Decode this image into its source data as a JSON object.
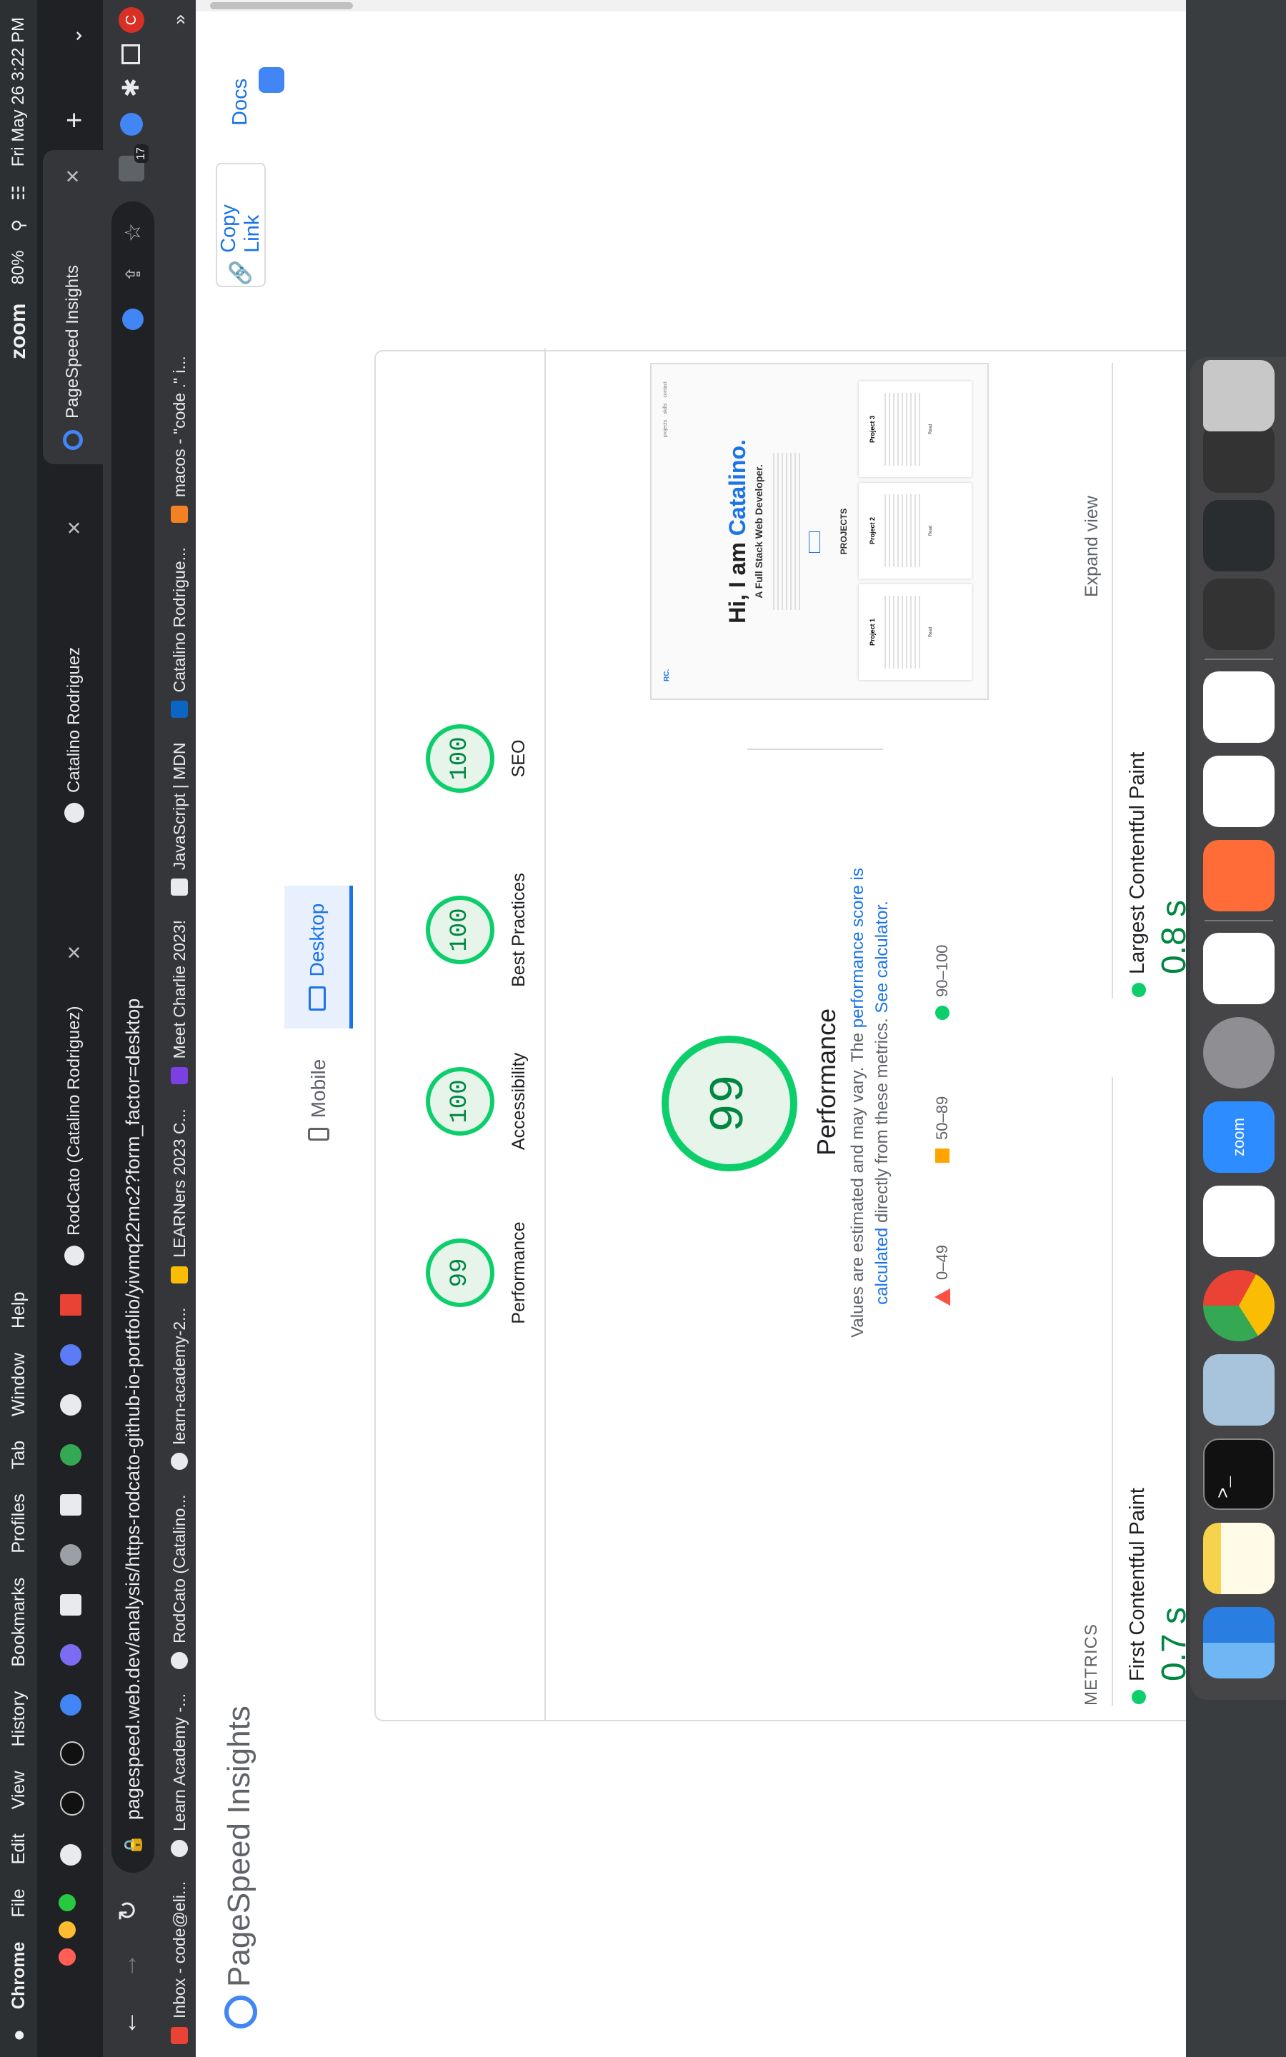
{
  "menubar": {
    "apple_icon": "apple-logo-icon",
    "items": [
      "Chrome",
      "File",
      "Edit",
      "View",
      "History",
      "Bookmarks",
      "Profiles",
      "Tab",
      "Window",
      "Help"
    ],
    "status": {
      "zoom": "zoom",
      "battery": "80%",
      "datetime": "Fri May 26  3:22 PM"
    }
  },
  "browser": {
    "active_tab": {
      "title": "PageSpeed Insights"
    },
    "other_tabs": [
      "RodCato (Catalino Rodriguez)",
      "Catalino Rodriguez"
    ],
    "url": "pagespeed.web.dev/analysis/https-rodcato-github-io-portfolio/yivmq22mc2?form_factor=desktop",
    "extension_badge": "17",
    "bookmarks": [
      "Inbox - code@eli...",
      "Learn Academy -...",
      "RodCato (Catalino...",
      "learn-academy-2...",
      "LEARNers 2023 C...",
      "Meet Charlie 2023!",
      "JavaScript | MDN",
      "Catalino Rodrigue...",
      "macos - \"code .\" i..."
    ]
  },
  "psi": {
    "title": "PageSpeed Insights",
    "copy_link": "Copy Link",
    "docs": "Docs",
    "tabs": {
      "mobile": "Mobile",
      "desktop": "Desktop"
    },
    "scores": [
      {
        "label": "Performance",
        "value": "99"
      },
      {
        "label": "Accessibility",
        "value": "100"
      },
      {
        "label": "Best Practices",
        "value": "100"
      },
      {
        "label": "SEO",
        "value": "100"
      }
    ],
    "performance": {
      "score": "99",
      "title": "Performance",
      "note_prefix": "Values are estimated and may vary. The",
      "note_link1": "performance score is calculated",
      "note_mid": "directly from these metrics.",
      "note_link2": "See calculator."
    },
    "legend": [
      {
        "range": "0–49",
        "color": "#ff4e42"
      },
      {
        "range": "50–89",
        "color": "#ffa400"
      },
      {
        "range": "90–100",
        "color": "#0cce6b"
      }
    ],
    "screenshot": {
      "logo": "RC.",
      "nav": [
        "projects",
        "skills",
        "contact"
      ],
      "heading_prefix": "Hi, I am",
      "heading_name": "Catalino.",
      "subheading": "A Full Stack Web Developer.",
      "section": "PROJECTS",
      "projects": [
        "Project 1",
        "Project 2",
        "Project 3"
      ],
      "project_button": "Read"
    },
    "expand_view": "Expand view",
    "metrics_label": "METRICS",
    "metrics": [
      {
        "name": "First Contentful Paint",
        "value": "0.7 s"
      },
      {
        "name": "Largest Contentful Paint",
        "value": "0.8 s"
      }
    ]
  },
  "dock": {
    "apps": [
      "finder-icon",
      "notes-icon",
      "terminal-icon",
      "database-icon",
      "chrome-icon",
      "slack-icon",
      "zoom-icon",
      "system-settings-icon",
      "vscode-icon",
      "postman-icon",
      "vscode-icon",
      "vscode-icon"
    ],
    "zoom_label": "zoom"
  }
}
